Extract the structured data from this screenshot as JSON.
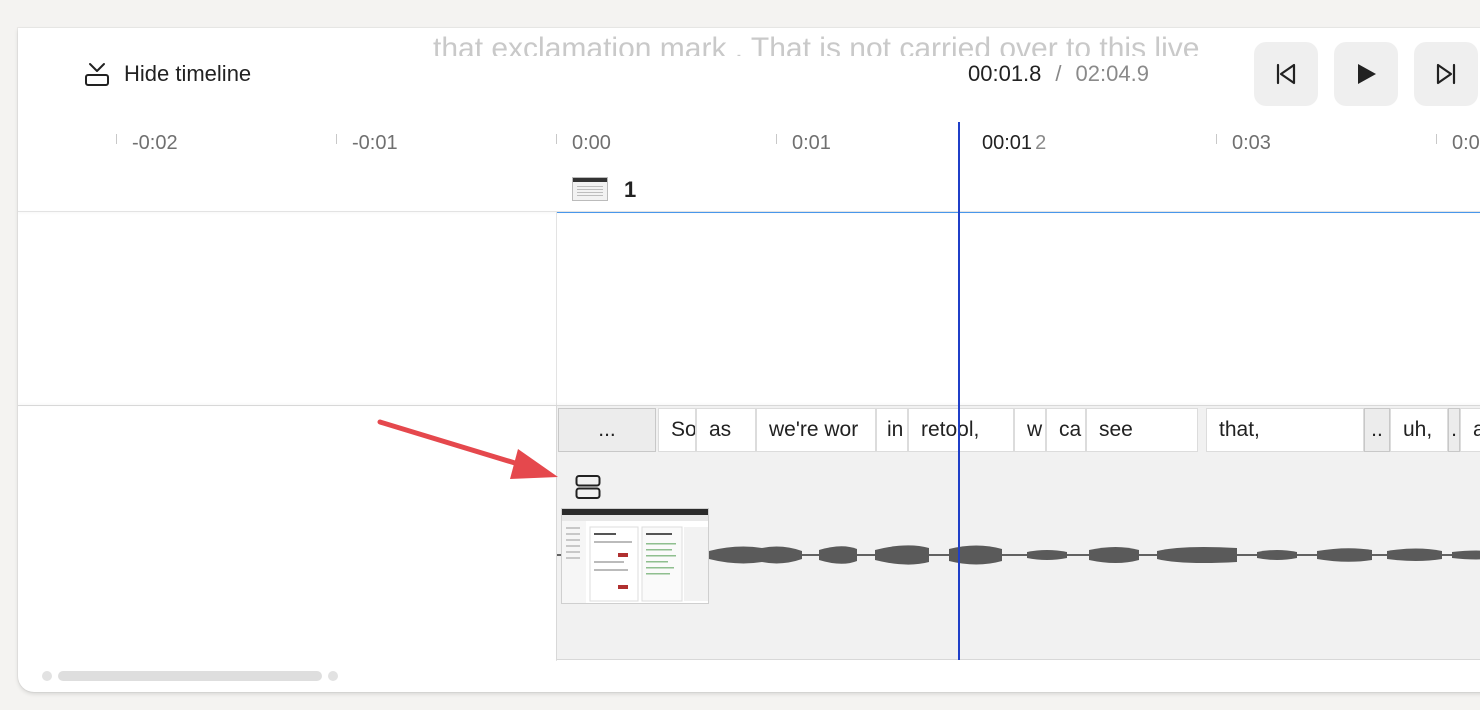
{
  "caption": {
    "text": "that exclamation mark . That is not carried over to this live"
  },
  "toolbar": {
    "hide_timeline_label": "Hide timeline",
    "current_time": "00:01.8",
    "separator": "/",
    "total_time": "02:04.9",
    "icons": {
      "hide_timeline": "collapse-down-icon",
      "previous": "skip-back-icon",
      "play": "play-icon",
      "next": "skip-forward-icon"
    }
  },
  "ruler": {
    "ticks": [
      "-0:02",
      "-0:01",
      "0:00",
      "0:01",
      "0:03",
      "0:0"
    ],
    "playhead_main": "00:01",
    "playhead_dim": "2"
  },
  "scene": {
    "number": "1"
  },
  "transcript": {
    "words": [
      "...",
      "So",
      "as",
      "we're wor",
      "in",
      "retool,",
      "w",
      "ca",
      "see",
      "that,",
      "..",
      "uh,",
      ".",
      "a"
    ]
  },
  "colors": {
    "playhead": "#1f3fc8",
    "scene_underline": "#4a9bf0",
    "annotation_arrow": "#e5484d"
  }
}
